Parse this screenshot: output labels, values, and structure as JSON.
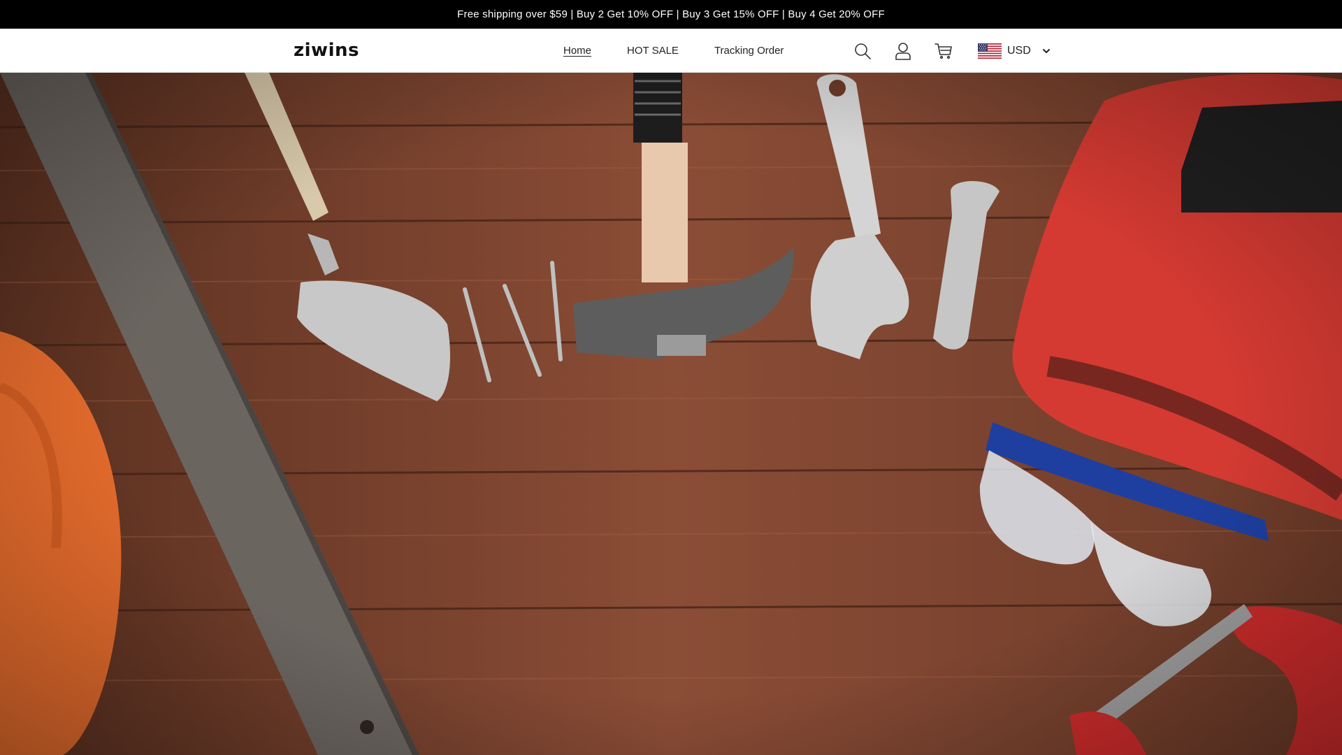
{
  "announcement": {
    "text": "Free shipping over $59 | Buy 2 Get 10% OFF | Buy 3 Get 15% OFF | Buy 4 Get 20% OFF"
  },
  "header": {
    "logo": "ziwins",
    "nav": [
      {
        "label": "Home",
        "active": true
      },
      {
        "label": "HOT SALE",
        "active": false
      },
      {
        "label": "Tracking Order",
        "active": false
      }
    ],
    "icons": [
      "search-icon",
      "account-icon",
      "cart-icon"
    ],
    "currency": {
      "flag": "us-flag-icon",
      "value": "USD"
    }
  },
  "hero": {
    "image": "hero-image-tools-on-wooden-table"
  },
  "colors": {
    "announcement_bg": "#000000",
    "announcement_text": "#ffffff",
    "header_bg": "#ffffff",
    "text": "#222222",
    "wood": "#7a4430"
  }
}
